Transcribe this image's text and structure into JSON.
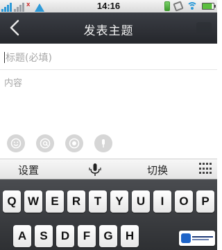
{
  "status_bar": {
    "time": "14:16",
    "network_label": "X",
    "icons": [
      "signal-icon",
      "signal-icon",
      "upload-arrow-icon",
      "charging-icon",
      "phone-icon",
      "wifi-icon",
      "battery-icon"
    ]
  },
  "header": {
    "title": "发表主题",
    "back_icon": "chevron-left-icon"
  },
  "form": {
    "title_placeholder": "标题(必填)",
    "content_placeholder": "内容"
  },
  "actions": [
    {
      "name": "emoji",
      "icon": "smiley-icon"
    },
    {
      "name": "mention",
      "icon": "at-icon"
    },
    {
      "name": "image",
      "icon": "camera-icon"
    },
    {
      "name": "voice",
      "icon": "microphone-icon"
    }
  ],
  "ime": {
    "settings_label": "设置",
    "switch_label": "切换",
    "mic_icon": "microphone-icon",
    "grid_icon": "keyboard-grid-icon"
  },
  "keyboard": {
    "row1": [
      "Q",
      "W",
      "E",
      "R",
      "T",
      "Y",
      "U",
      "I",
      "O",
      "P"
    ],
    "row2": [
      "A",
      "S",
      "D",
      "F",
      "G",
      "H"
    ]
  },
  "colors": {
    "header_bg": "#2c2e33",
    "accent_blue": "#2e9ad8",
    "placeholder": "#a6a6a6"
  }
}
